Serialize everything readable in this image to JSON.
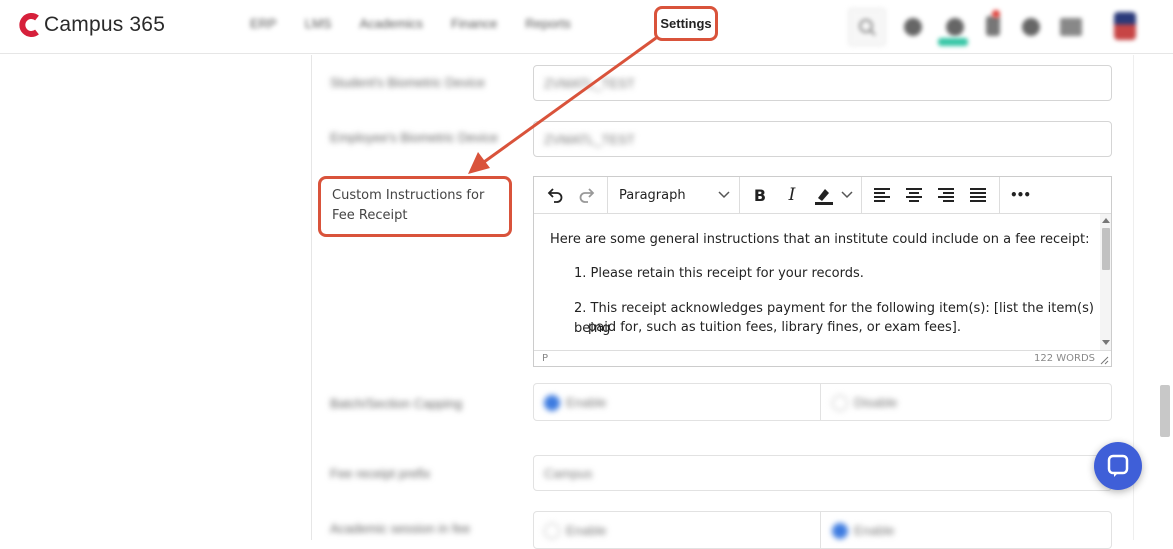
{
  "app": {
    "logo_text": "Campus 365",
    "brand_color": "#d6203b",
    "accent_color": "#d9533b"
  },
  "nav": {
    "items": [
      "ERP",
      "LMS",
      "Academics",
      "Finance",
      "Reports"
    ],
    "settings_label": "Settings"
  },
  "top_icons": [
    "search-icon",
    "globe-icon",
    "apps-icon",
    "notifications-icon",
    "help-icon",
    "calendar-icon",
    "user-avatar"
  ],
  "form": {
    "fields_blurred": [
      {
        "label": "Student's Biometric Device",
        "value": "ZVMATL_TEST"
      },
      {
        "label": "Employee's Biometric Device",
        "value": "ZVMATL_TEST"
      }
    ],
    "custom_instructions": {
      "label": "Custom Instructions for Fee Receipt",
      "toolbar": {
        "undo": "undo-icon",
        "redo": "redo-icon",
        "block_format": "Paragraph",
        "bold": "B",
        "italic": "I",
        "highlight": "highlight-icon",
        "align_left": "align-left-icon",
        "align_center": "align-center-icon",
        "align_right": "align-right-icon",
        "justify": "justify-icon",
        "more": "•••"
      },
      "content": {
        "intro": "Here are some general instructions that an institute could include on a fee receipt:",
        "items": [
          "1. Please retain this receipt for your records.",
          "2. This receipt acknowledges payment for the following item(s): [list the item(s) being",
          "paid for, such as tuition fees, library fines, or exam fees]."
        ]
      },
      "status_path": "P",
      "word_count": "122 WORDS"
    },
    "fields_below": [
      {
        "label": "Batch/Section Capping",
        "options": [
          "Enable",
          "Disable"
        ],
        "selected": "Enable"
      },
      {
        "label": "Fee receipt prefix",
        "value": "Campus"
      },
      {
        "label": "Academic session in fee",
        "options": [
          "Enable",
          "Enable"
        ],
        "selected_index": 1
      }
    ]
  }
}
